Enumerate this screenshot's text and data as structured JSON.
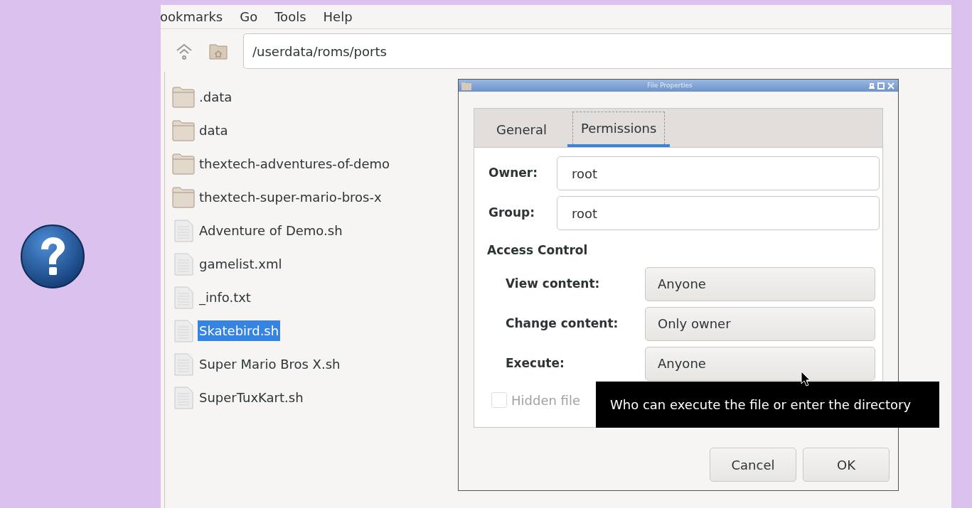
{
  "menu_bar": [
    "ookmarks",
    "Go",
    "Tools",
    "Help"
  ],
  "location_bar": {
    "value": "/userdata/roms/ports"
  },
  "files": [
    {
      "name": ".data",
      "kind": "folder",
      "selected": false
    },
    {
      "name": "data",
      "kind": "folder",
      "selected": false
    },
    {
      "name": "thextech-adventures-of-demo",
      "kind": "folder",
      "selected": false
    },
    {
      "name": "thextech-super-mario-bros-x",
      "kind": "folder",
      "selected": false
    },
    {
      "name": "Adventure of Demo.sh",
      "kind": "file",
      "selected": false
    },
    {
      "name": "gamelist.xml",
      "kind": "file",
      "selected": false
    },
    {
      "name": "_info.txt",
      "kind": "file",
      "selected": false
    },
    {
      "name": "Skatebird.sh",
      "kind": "file",
      "selected": true
    },
    {
      "name": "Super Mario Bros X.sh",
      "kind": "file",
      "selected": false
    },
    {
      "name": "SuperTuxKart.sh",
      "kind": "file",
      "selected": false
    }
  ],
  "dialog": {
    "title": "File Properties",
    "tabs": [
      {
        "label": "General",
        "selected": false
      },
      {
        "label": "Permissions",
        "selected": true
      }
    ],
    "owner": {
      "label": "Owner:",
      "value": "root"
    },
    "group": {
      "label": "Group:",
      "value": "root"
    },
    "access_heading": "Access Control",
    "access": [
      {
        "label": "View content:",
        "value": "Anyone"
      },
      {
        "label": "Change content:",
        "value": "Only owner"
      },
      {
        "label": "Execute:",
        "value": "Anyone"
      }
    ],
    "hidden_file": {
      "label": "Hidden file",
      "checked": false,
      "disabled": true
    },
    "tooltip": "Who can execute the file or enter the directory",
    "buttons": [
      "Cancel",
      "OK"
    ]
  }
}
